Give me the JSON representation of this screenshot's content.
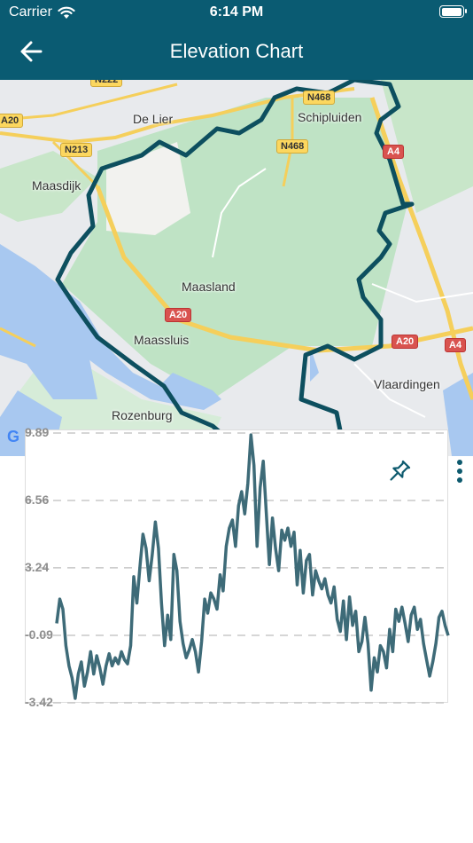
{
  "status_bar": {
    "carrier": "Carrier",
    "time": "6:14 PM",
    "battery_level": 1.0
  },
  "nav": {
    "title": "Elevation Chart",
    "back_icon": "arrow-left-icon"
  },
  "map": {
    "places": [
      "De Lier",
      "Schipluiden",
      "Maasdijk",
      "Maasland",
      "Maassluis",
      "Vlaardingen",
      "Rozenburg"
    ],
    "roads": [
      "N222",
      "N468",
      "N213",
      "N468",
      "A4",
      "A20",
      "A20",
      "A4",
      "A20"
    ],
    "attribution": "G",
    "boundary_color": "#0d4f5f"
  },
  "chart_controls": {
    "pin_icon": "pin-icon",
    "menu_icon": "more-vertical-icon"
  },
  "chart_data": {
    "type": "line",
    "title": "",
    "xlabel": "",
    "ylabel": "",
    "ylim": [
      -3.42,
      9.89
    ],
    "y_ticks": [
      "9.89",
      "6.56",
      "3.24",
      "-0.09",
      "-3.42"
    ],
    "grid": true,
    "line_color": "#3e6b78",
    "series": [
      {
        "values": [
          0.5,
          1.7,
          1.2,
          -0.6,
          -1.6,
          -2.2,
          -3.2,
          -2.0,
          -1.4,
          -2.6,
          -1.9,
          -0.9,
          -2.0,
          -1.1,
          -1.7,
          -2.5,
          -1.6,
          -1.0,
          -1.6,
          -1.2,
          -1.5,
          -0.9,
          -1.3,
          -1.5,
          -0.6,
          2.8,
          1.5,
          3.3,
          4.9,
          4.2,
          2.6,
          3.9,
          5.5,
          4.2,
          1.5,
          -0.6,
          0.9,
          -0.3,
          3.9,
          3.1,
          0.6,
          -0.5,
          -1.2,
          -0.8,
          -0.3,
          -0.9,
          -1.9,
          -0.4,
          1.7,
          1.0,
          2.0,
          1.7,
          1.2,
          2.9,
          2.1,
          4.3,
          5.2,
          5.6,
          4.3,
          6.3,
          7.0,
          5.9,
          7.4,
          9.8,
          8.3,
          4.3,
          7.2,
          8.5,
          5.9,
          3.4,
          5.7,
          4.2,
          3.1,
          5.1,
          4.6,
          5.2,
          4.3,
          5.0,
          2.4,
          4.1,
          2.0,
          3.6,
          3.9,
          1.9,
          3.1,
          2.6,
          2.2,
          2.7,
          1.9,
          1.5,
          2.3,
          0.7,
          0.1,
          1.6,
          -0.3,
          1.8,
          0.4,
          1.1,
          -0.9,
          -0.4,
          0.8,
          -0.5,
          -2.8,
          -1.2,
          -1.9,
          -0.6,
          -0.9,
          -1.7,
          0.2,
          -0.9,
          1.2,
          0.6,
          1.3,
          0.5,
          -0.4,
          0.9,
          1.3,
          0.2,
          0.7,
          -0.5,
          -1.3,
          -2.1,
          -1.4,
          -0.5,
          0.8,
          1.1,
          0.4,
          -0.1
        ]
      }
    ]
  }
}
